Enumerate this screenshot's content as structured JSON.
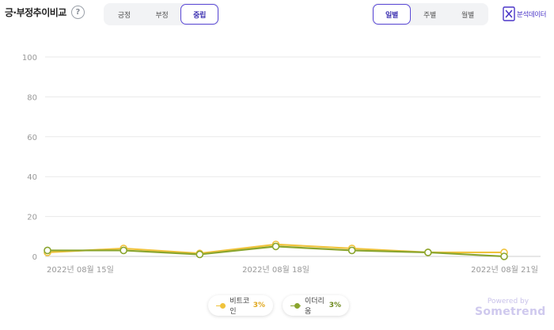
{
  "header": {
    "title": "긍·부정추이비교",
    "help_symbol": "?",
    "sentiment_tabs": [
      "긍정",
      "부정",
      "중립"
    ],
    "sentiment_selected": "중립",
    "period_tabs": [
      "일별",
      "주별",
      "월별"
    ],
    "period_selected": "일별",
    "export_label": "분석데이터",
    "export_icon": "excel-x-icon"
  },
  "chart_data": {
    "type": "line",
    "x": [
      "2022-08-15",
      "2022-08-16",
      "2022-08-17",
      "2022-08-18",
      "2022-08-19",
      "2022-08-20",
      "2022-08-21"
    ],
    "x_tick_labels": [
      "2022년 08월 15일",
      "2022년 08월 18일",
      "2022년 08월 21일"
    ],
    "x_tick_positions": [
      "2022-08-15",
      "2022-08-18",
      "2022-08-21"
    ],
    "ylim": [
      0,
      100
    ],
    "y_ticks": [
      0,
      20,
      40,
      60,
      80,
      100
    ],
    "grid": true,
    "legend_position": "bottom-center",
    "series": [
      {
        "name": "비트코인",
        "color": "#f0c33c",
        "pct_label": "3%",
        "values": [
          2,
          4,
          1.5,
          6,
          4,
          2,
          2
        ]
      },
      {
        "name": "이더리움",
        "color": "#8aa52e",
        "pct_label": "3%",
        "values": [
          3,
          3,
          1,
          5,
          3,
          2,
          0
        ]
      }
    ]
  },
  "branding": {
    "powered_by": "Powered by",
    "brand": "Sometrend"
  }
}
